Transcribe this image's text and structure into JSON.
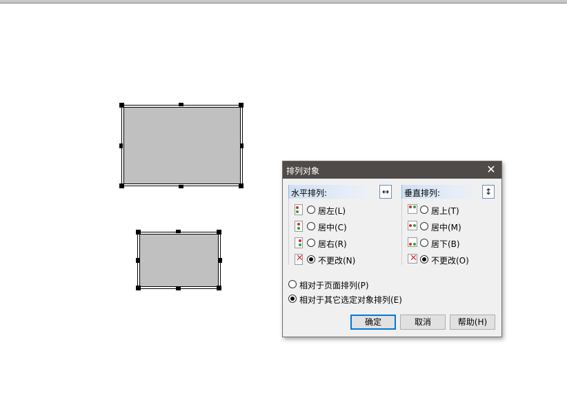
{
  "dialog": {
    "title": "排列对象",
    "close_symbol": "✕",
    "horizontal": {
      "label": "水平排列:",
      "icon": "↔",
      "options": [
        {
          "label": "居左(L)",
          "selected": false
        },
        {
          "label": "居中(C)",
          "selected": false
        },
        {
          "label": "居右(R)",
          "selected": false
        },
        {
          "label": "不更改(N)",
          "selected": true
        }
      ]
    },
    "vertical": {
      "label": "垂直排列:",
      "icon": "↕",
      "options": [
        {
          "label": "居上(T)",
          "selected": false
        },
        {
          "label": "居中(M)",
          "selected": false
        },
        {
          "label": "居下(B)",
          "selected": false
        },
        {
          "label": "不更改(O)",
          "selected": true
        }
      ]
    },
    "relative": [
      {
        "label": "相对于页面排列(P)",
        "selected": false
      },
      {
        "label": "相对于其它选定对象排列(E)",
        "selected": true
      }
    ],
    "buttons": {
      "ok": "确定",
      "cancel": "取消",
      "help": "帮助(H)"
    },
    "colors": {
      "titlebar": "#4f4b48",
      "accent": "#0078d7",
      "shape_fill": "#c0c0c0",
      "marker_red": "#d03030",
      "marker_green": "#2ea040"
    }
  }
}
